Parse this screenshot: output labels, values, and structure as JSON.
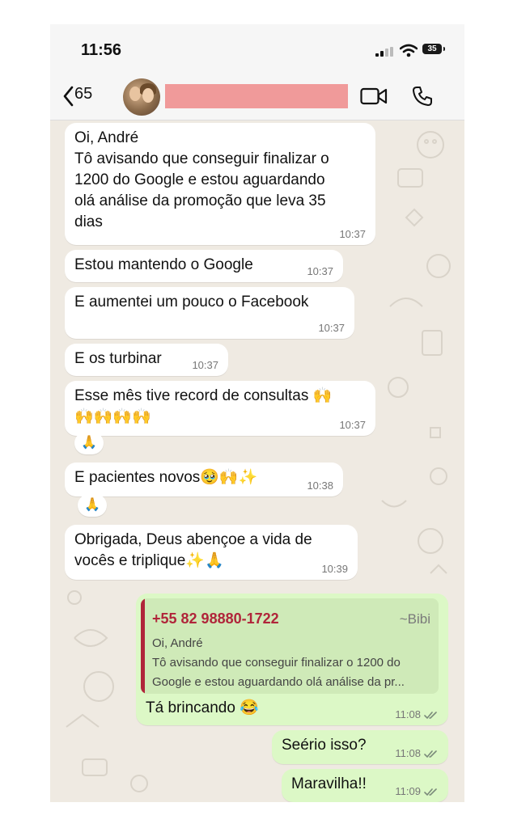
{
  "status": {
    "time": "11:56",
    "battery": "35"
  },
  "header": {
    "back_count": "65"
  },
  "messages": [
    {
      "lines": [
        "Oi, André",
        "Tô avisando que conseguir finalizar o",
        "1200 do Google e estou aguardando",
        "olá análise da promoção que leva 35",
        "dias"
      ],
      "time": "10:37"
    },
    {
      "text": "Estou mantendo o Google",
      "time": "10:37"
    },
    {
      "text": "E aumentei um pouco o Facebook",
      "time": "10:37"
    },
    {
      "text": "E os turbinar",
      "time": "10:37"
    },
    {
      "lines": [
        "Esse mês tive record de consultas 🙌",
        "🙌🙌🙌🙌"
      ],
      "time": "10:37",
      "reaction": "🙏"
    },
    {
      "text": "E pacientes novos🥹🙌✨",
      "time": "10:38",
      "reaction": "🙏"
    },
    {
      "lines": [
        "Obrigada, Deus abençoe a vida de",
        "vocês e triplique✨🙏"
      ],
      "time": "10:39"
    }
  ],
  "reply": {
    "quote_phone": "+55 82 98880-1722",
    "quote_author": "~Bibi",
    "quote_lines": [
      "Oi, André",
      "Tô avisando que conseguir finalizar o 1200 do",
      "Google e estou aguardando olá análise da pr..."
    ],
    "text": "Tá brincando 😂",
    "time": "11:08"
  },
  "outgoing": [
    {
      "text": "Seério isso?",
      "time": "11:08"
    },
    {
      "text": "Maravilha!!",
      "time": "11:09"
    }
  ],
  "colors": {
    "chat_bg": "#efeae2",
    "incoming": "#ffffff",
    "outgoing": "#dcf8c6",
    "quote_accent": "#b0253a",
    "redaction": "#f09a9a"
  }
}
